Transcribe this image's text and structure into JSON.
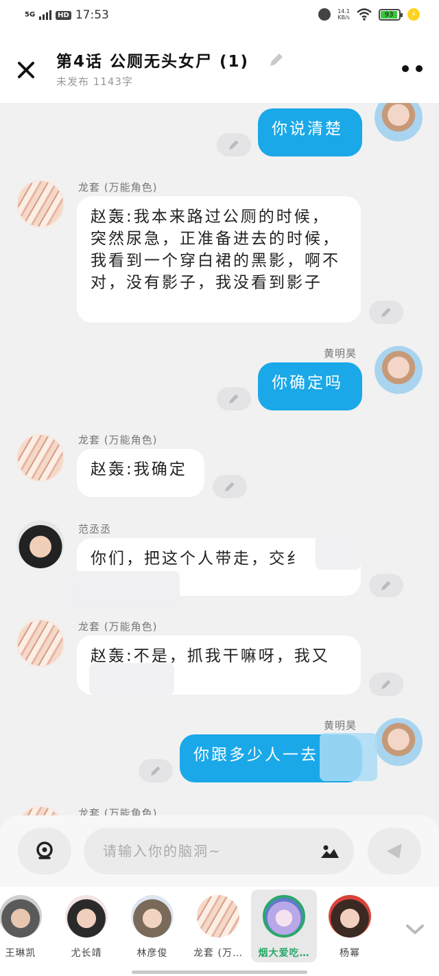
{
  "status_bar": {
    "network": "5G",
    "hd": "HD",
    "time": "17:53",
    "speed_value": "14.1",
    "speed_unit": "KB/s",
    "battery": "93"
  },
  "header": {
    "title": "第4话  公厕无头女尸 (1)",
    "subtitle": "未发布 1143字"
  },
  "messages": [
    {
      "side": "right",
      "text": "你说清楚"
    },
    {
      "side": "left",
      "speaker": "龙套 (万能角色)",
      "text": "赵轰:我本来路过公厕的时候，突然尿急，正准备进去的时候，我看到一个穿白裙的黑影，啊不对，没有影子，我没看到影子"
    },
    {
      "side": "right",
      "speaker": "黄明昊",
      "text": "你确定吗"
    },
    {
      "side": "left",
      "speaker": "龙套 (万能角色)",
      "text": "赵轰:我确定"
    },
    {
      "side": "left",
      "speaker": "范丞丞",
      "text": "你们，把这个人带走，交纟"
    },
    {
      "side": "left",
      "speaker": "龙套 (万能角色)",
      "text": "赵轰:不是，抓我干嘛呀，我又"
    },
    {
      "side": "right",
      "speaker": "黄明昊",
      "text": "你跟多少人一去"
    },
    {
      "side": "left",
      "speaker": "龙套 (万能角色)"
    }
  ],
  "input": {
    "placeholder": "请输入你的脑洞~"
  },
  "characters": [
    "王琳凯",
    "尤长靖",
    "林彦俊",
    "龙套 (万…",
    "烟大爱吃…",
    "杨幂"
  ],
  "icons": {
    "close": "close-icon",
    "edit": "pencil-icon",
    "more": "more-icon",
    "camera": "camera-icon",
    "image": "image-icon",
    "send": "send-icon",
    "collapse": "chevron-down-icon"
  },
  "colors": {
    "my_bubble": "#1aa8e8",
    "active_character": "#2aa86a",
    "battery": "#3cc43c"
  }
}
